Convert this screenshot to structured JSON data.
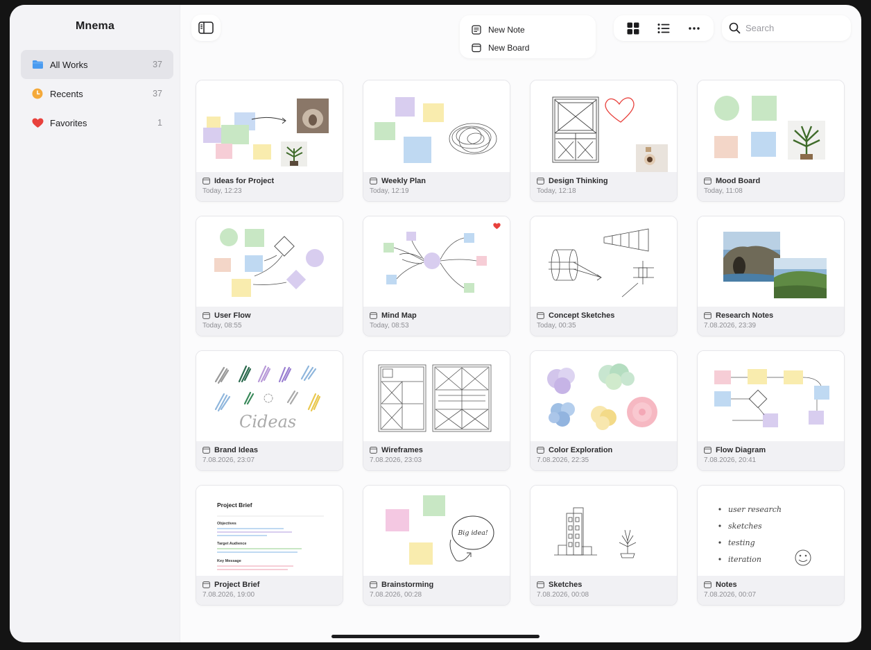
{
  "app": {
    "title": "Mnema"
  },
  "sidebar": {
    "items": [
      {
        "label": "All Works",
        "count": "37"
      },
      {
        "label": "Recents",
        "count": "37"
      },
      {
        "label": "Favorites",
        "count": "1"
      }
    ]
  },
  "toolbar": {
    "new_menu": {
      "new_note": "New Note",
      "new_board": "New Board"
    },
    "search_placeholder": "Search"
  },
  "colors": {
    "accent_blue": "#4a9bf0",
    "recents_orange": "#f4a93a",
    "favorite_red": "#e8413c"
  },
  "cards": [
    {
      "title": "Ideas for Project",
      "date": "Today, 12:23"
    },
    {
      "title": "Weekly Plan",
      "date": "Today, 12:19"
    },
    {
      "title": "Design Thinking",
      "date": "Today, 12:18"
    },
    {
      "title": "Mood Board",
      "date": "Today, 11:08"
    },
    {
      "title": "User Flow",
      "date": "Today, 08:55"
    },
    {
      "title": "Mind Map",
      "date": "Today, 08:53",
      "favorite": true
    },
    {
      "title": "Concept Sketches",
      "date": "Today, 00:35"
    },
    {
      "title": "Research Notes",
      "date": "7.08.2026, 23:39"
    },
    {
      "title": "Brand Ideas",
      "date": "7.08.2026, 23:07"
    },
    {
      "title": "Wireframes",
      "date": "7.08.2026, 23:03"
    },
    {
      "title": "Color Exploration",
      "date": "7.08.2026, 22:35"
    },
    {
      "title": "Flow Diagram",
      "date": "7.08.2026, 20:41"
    },
    {
      "title": "Project Brief",
      "date": "7.08.2026, 19:00"
    },
    {
      "title": "Brainstorming",
      "date": "7.08.2026, 00:28"
    },
    {
      "title": "Sketches",
      "date": "7.08.2026, 00:08"
    },
    {
      "title": "Notes",
      "date": "7.08.2026, 00:07"
    }
  ],
  "thumb_text": {
    "brand_ideas": "Cideas",
    "brief": {
      "title": "Project Brief",
      "s1": "Objectives",
      "s2": "Target Audience",
      "s3": "Key Message"
    },
    "brainstorm": "Big idea!",
    "notes": [
      "user research",
      "sketches",
      "testing",
      "iteration"
    ]
  }
}
